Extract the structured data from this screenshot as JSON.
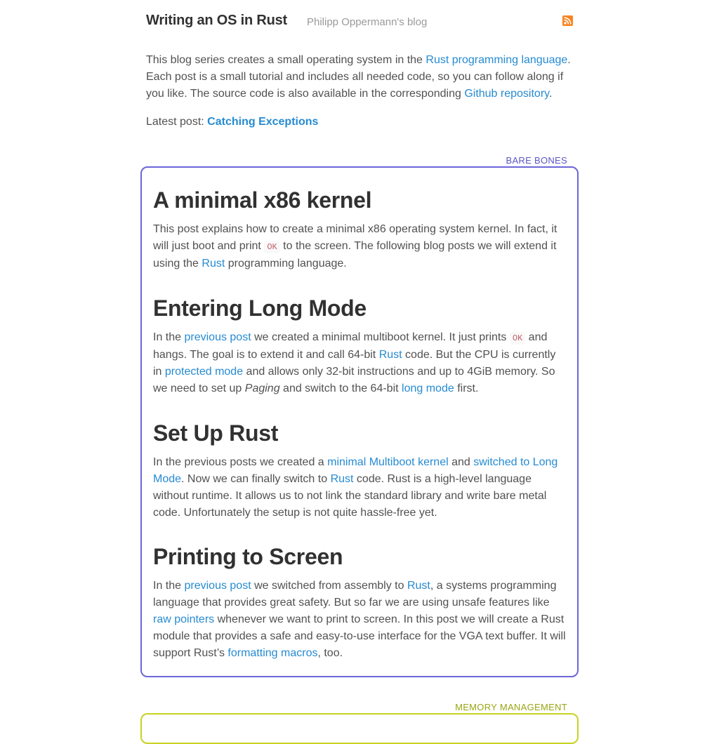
{
  "masthead": {
    "title": "Writing an OS in Rust",
    "subtitle": "Philipp Oppermann's blog",
    "rss_icon": "rss-icon",
    "rss_color": "#f78422"
  },
  "intro": {
    "t1": "This blog series creates a small operating system in the ",
    "l1": "Rust programming language",
    "t2": ". Each post is a small tutorial and includes all needed code, so you can follow along if you like. The source code is also available in the corresponding ",
    "l2": "Github repository",
    "t3": "."
  },
  "latest": {
    "label": "Latest post: ",
    "link": "Catching Exceptions"
  },
  "categories": {
    "bare_bones": "BARE BONES",
    "memory_management": "MEMORY MANAGEMENT"
  },
  "colors": {
    "link": "#268bd2",
    "bare_bones_border": "#6b66d9",
    "memory_border": "#c7d323",
    "code": "#bf616a"
  },
  "posts": [
    {
      "title": "A minimal x86 kernel",
      "t1": "This post explains how to create a minimal x86 operating system kernel. In fact, it will just boot and print ",
      "code": "OK",
      "t2": " to the screen. The following blog posts we will extend it using the ",
      "l1": "Rust",
      "t3": " programming language."
    },
    {
      "title": "Entering Long Mode",
      "t1": "In the ",
      "l1": "previous post",
      "t2": " we created a minimal multiboot kernel. It just prints ",
      "code": "OK",
      "t3": " and hangs. The goal is to extend it and call 64-bit ",
      "l2": "Rust",
      "t4": " code. But the CPU is currently in ",
      "l3": "protected mode",
      "t5": " and allows only 32-bit instructions and up to 4GiB memory. So we need to set up ",
      "em": "Paging",
      "t6": " and switch to the 64-bit ",
      "l4": "long mode",
      "t7": " first."
    },
    {
      "title": "Set Up Rust",
      "t1": "In the previous posts we created a ",
      "l1": "minimal Multiboot kernel",
      "t2": " and ",
      "l2": "switched to Long Mode",
      "t3": ". Now we can finally switch to ",
      "l3": "Rust",
      "t4": " code. Rust is a high-level language without runtime. It allows us to not link the standard library and write bare metal code. Unfortunately the setup is not quite hassle-free yet."
    },
    {
      "title": "Printing to Screen",
      "t1": "In the ",
      "l1": "previous post",
      "t2": " we switched from assembly to ",
      "l2": "Rust",
      "t3": ", a systems programming language that provides great safety. But so far we are using unsafe features like ",
      "l3": "raw pointers",
      "t4": " whenever we want to print to screen. In this post we will create a Rust module that provides a safe and easy-to-use interface for the VGA text buffer. It will support Rust’s ",
      "l4": "formatting macros",
      "t5": ", too."
    }
  ]
}
